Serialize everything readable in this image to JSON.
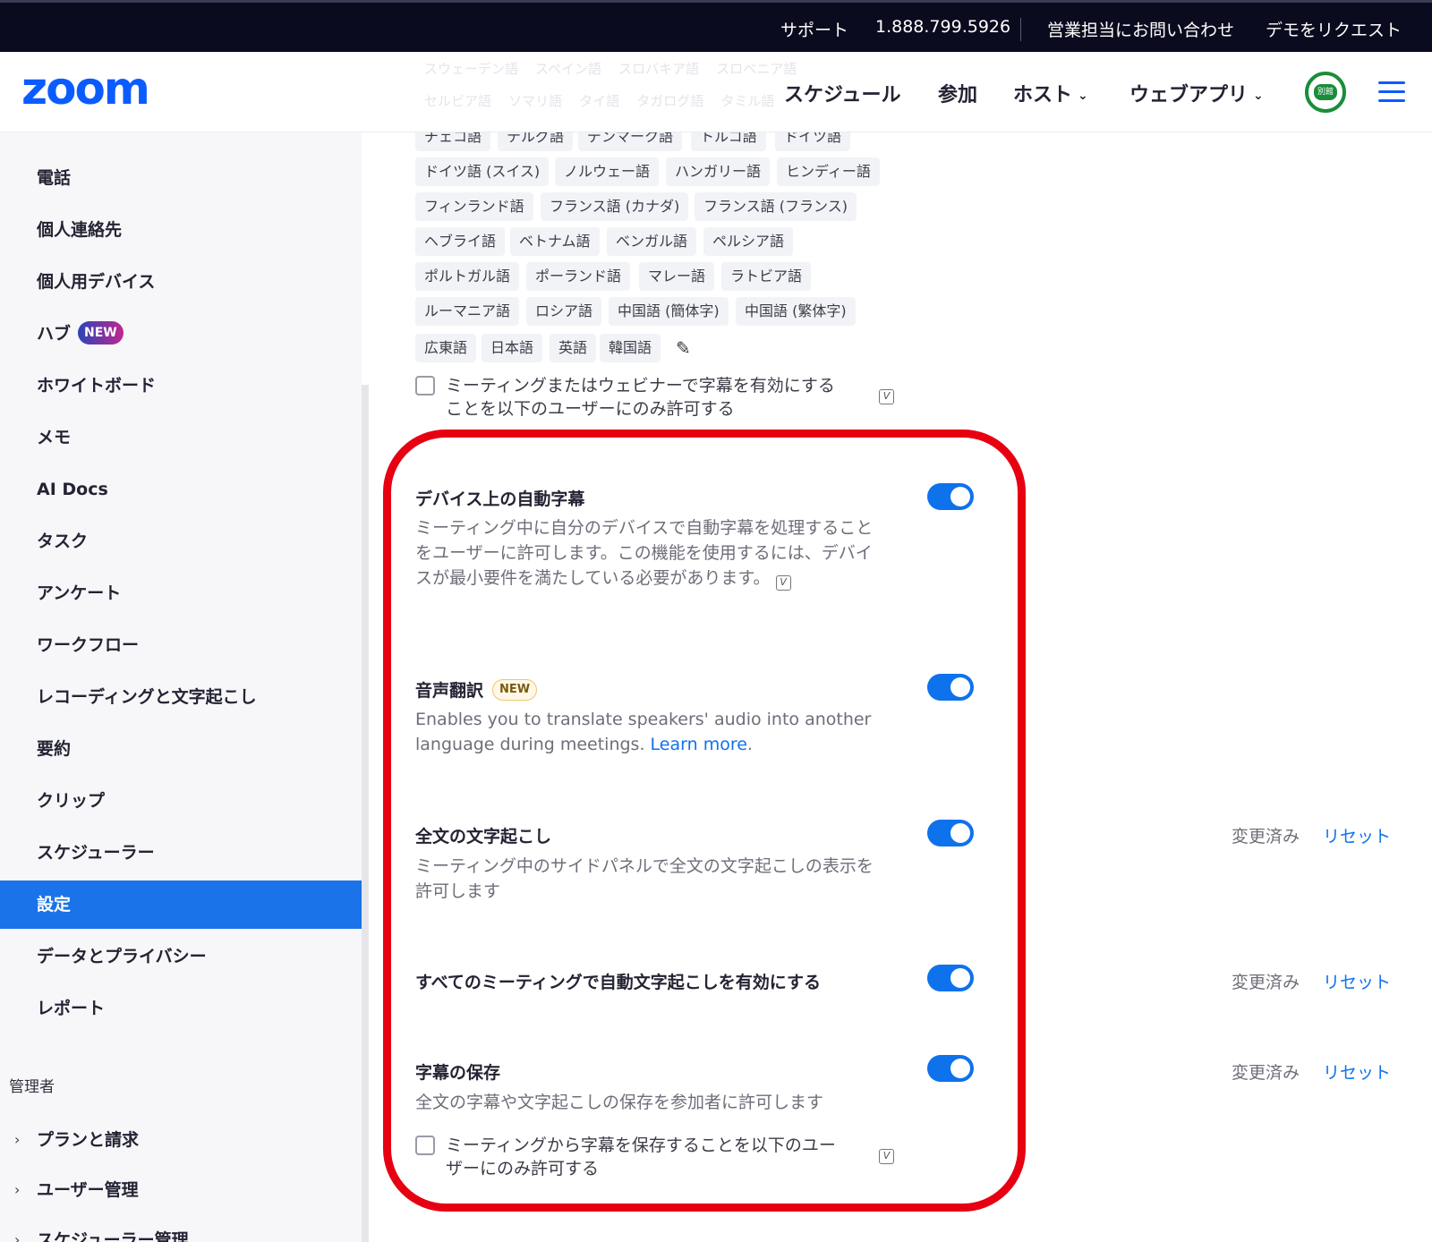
{
  "topbar": {
    "support": "サポート",
    "phone": "1.888.799.5926",
    "contact_sales": "営業担当にお問い合わせ",
    "request_demo": "デモをリクエスト"
  },
  "header": {
    "logo": "zoom",
    "nav": {
      "schedule": "スケジュール",
      "join": "参加",
      "host": "ホスト",
      "web_app": "ウェブアプリ"
    },
    "avatar_text": "別館",
    "ghost_langs_row1": [
      "スウェーデン語",
      "スペイン語",
      "スロバキア語",
      "スロベニア語"
    ],
    "ghost_langs_row2": [
      "セルビア語",
      "ソマリ語",
      "タイ語",
      "タガログ語",
      "タミル語"
    ]
  },
  "sidebar": {
    "items": [
      "電話",
      "個人連絡先",
      "個人用デバイス",
      "ハブ",
      "ホワイトボード",
      "メモ",
      "AI Docs",
      "タスク",
      "アンケート",
      "ワークフロー",
      "レコーディングと文字起こし",
      "要約",
      "クリップ",
      "スケジューラー",
      "設定",
      "データとプライバシー",
      "レポート"
    ],
    "hub_badge": "NEW",
    "group_label": "管理者",
    "admin_items": [
      "プランと請求",
      "ユーザー管理",
      "スケジューラー管理"
    ]
  },
  "languages": [
    [
      "チェコ語",
      "テルグ語",
      "デンマーク語",
      "トルコ語",
      "ドイツ語"
    ],
    [
      "ドイツ語 (スイス)",
      "ノルウェー語",
      "ハンガリー語",
      "ヒンディー語"
    ],
    [
      "フィンランド語",
      "フランス語 (カナダ)",
      "フランス語 (フランス)"
    ],
    [
      "ヘブライ語",
      "ベトナム語",
      "ベンガル語",
      "ペルシア語"
    ],
    [
      "ポルトガル語",
      "ポーランド語",
      "マレー語",
      "ラトビア語"
    ],
    [
      "ルーマニア語",
      "ロシア語",
      "中国語 (簡体字)",
      "中国語 (繁体字)"
    ],
    [
      "広東語",
      "日本語",
      "英語",
      "韓国語"
    ]
  ],
  "caption_restrict": {
    "line1": "ミーティングまたはウェビナーで字幕を有効にする",
    "line2": "ことを以下のユーザーにのみ許可する"
  },
  "settings": {
    "device_captions": {
      "title": "デバイス上の自動字幕",
      "desc_l1": "ミーティング中に自分のデバイスで自動字幕を処理すること",
      "desc_l2": "をユーザーに許可します。この機能を使用するには、デバイ",
      "desc_l3": "スが最小要件を満たしている必要があります。",
      "enabled": true
    },
    "voice_translation": {
      "title": "音声翻訳",
      "badge": "NEW",
      "desc_l1": "Enables you to translate speakers' audio into another",
      "desc_l2": "language during meetings.",
      "learn_more": "Learn more",
      "period": ".",
      "enabled": true
    },
    "full_transcript": {
      "title": "全文の文字起こし",
      "desc_l1": "ミーティング中のサイドパネルで全文の文字起こしの表示を",
      "desc_l2": "許可します",
      "modified": "変更済み",
      "reset": "リセット",
      "enabled": true
    },
    "auto_transcript": {
      "title": "すべてのミーティングで自動文字起こしを有効にする",
      "modified": "変更済み",
      "reset": "リセット",
      "enabled": true
    },
    "save_captions": {
      "title": "字幕の保存",
      "desc": "全文の字幕や文字起こしの保存を参加者に許可します",
      "modified": "変更済み",
      "reset": "リセット",
      "enabled": true,
      "restrict_l1": "ミーティングから字幕を保存することを以下のユー",
      "restrict_l2": "ザーにのみ許可する"
    }
  },
  "colors": {
    "accent": "#0e72ed",
    "sidebar_active": "#1a73e8",
    "highlight": "#e60012",
    "topbar": "#0b0b1f"
  }
}
